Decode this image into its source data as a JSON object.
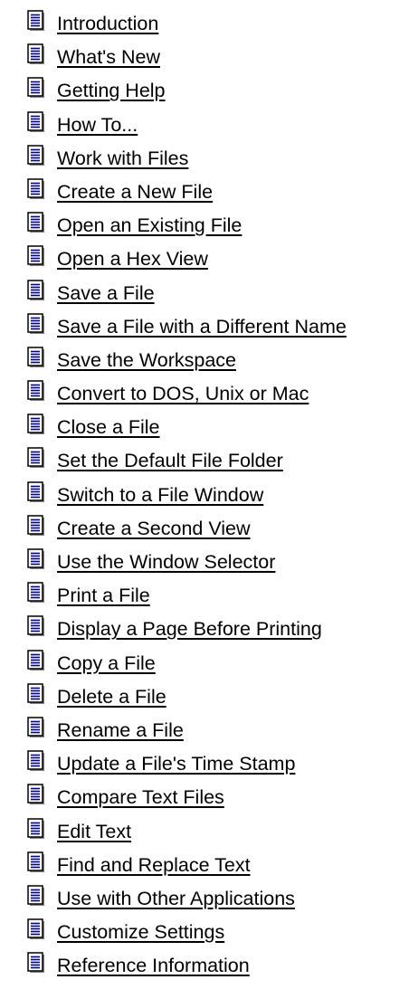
{
  "topics": [
    {
      "label": "Introduction",
      "icon": "document-page-icon"
    },
    {
      "label": "What's New",
      "icon": "document-page-icon"
    },
    {
      "label": "Getting Help",
      "icon": "document-page-icon"
    },
    {
      "label": "How To...",
      "icon": "document-page-icon"
    },
    {
      "label": "Work with Files",
      "icon": "document-page-icon"
    },
    {
      "label": "Create a New File",
      "icon": "document-page-icon"
    },
    {
      "label": "Open an Existing File",
      "icon": "document-page-icon"
    },
    {
      "label": "Open a Hex View",
      "icon": "document-page-icon"
    },
    {
      "label": "Save a File",
      "icon": "document-page-icon"
    },
    {
      "label": "Save a File with a Different Name",
      "icon": "document-page-icon"
    },
    {
      "label": "Save the Workspace",
      "icon": "document-page-icon"
    },
    {
      "label": "Convert to DOS, Unix or Mac",
      "icon": "document-page-icon"
    },
    {
      "label": "Close a File",
      "icon": "document-page-icon"
    },
    {
      "label": "Set the Default File Folder",
      "icon": "document-page-icon"
    },
    {
      "label": "Switch to a File Window",
      "icon": "document-page-icon"
    },
    {
      "label": "Create a Second View",
      "icon": "document-page-icon"
    },
    {
      "label": "Use the Window Selector",
      "icon": "document-page-icon"
    },
    {
      "label": "Print a File",
      "icon": "document-page-icon"
    },
    {
      "label": "Display a Page Before Printing",
      "icon": "document-page-icon"
    },
    {
      "label": "Copy a File",
      "icon": "document-page-icon"
    },
    {
      "label": "Delete a File",
      "icon": "document-page-icon"
    },
    {
      "label": "Rename a File",
      "icon": "document-page-icon"
    },
    {
      "label": "Update a File's Time Stamp",
      "icon": "document-page-icon"
    },
    {
      "label": "Compare Text Files",
      "icon": "document-page-icon"
    },
    {
      "label": "Edit Text",
      "icon": "document-page-icon"
    },
    {
      "label": "Find and Replace Text",
      "icon": "document-page-icon"
    },
    {
      "label": "Use with Other Applications",
      "icon": "document-page-icon"
    },
    {
      "label": "Customize Settings",
      "icon": "document-page-icon"
    },
    {
      "label": "Reference Information",
      "icon": "document-page-icon"
    }
  ],
  "colors": {
    "link": "#000000",
    "background": "#ffffff",
    "icon_fill": "#ffffff",
    "icon_border": "#000000",
    "icon_shadow": "#808080",
    "icon_lines": "#000080"
  }
}
